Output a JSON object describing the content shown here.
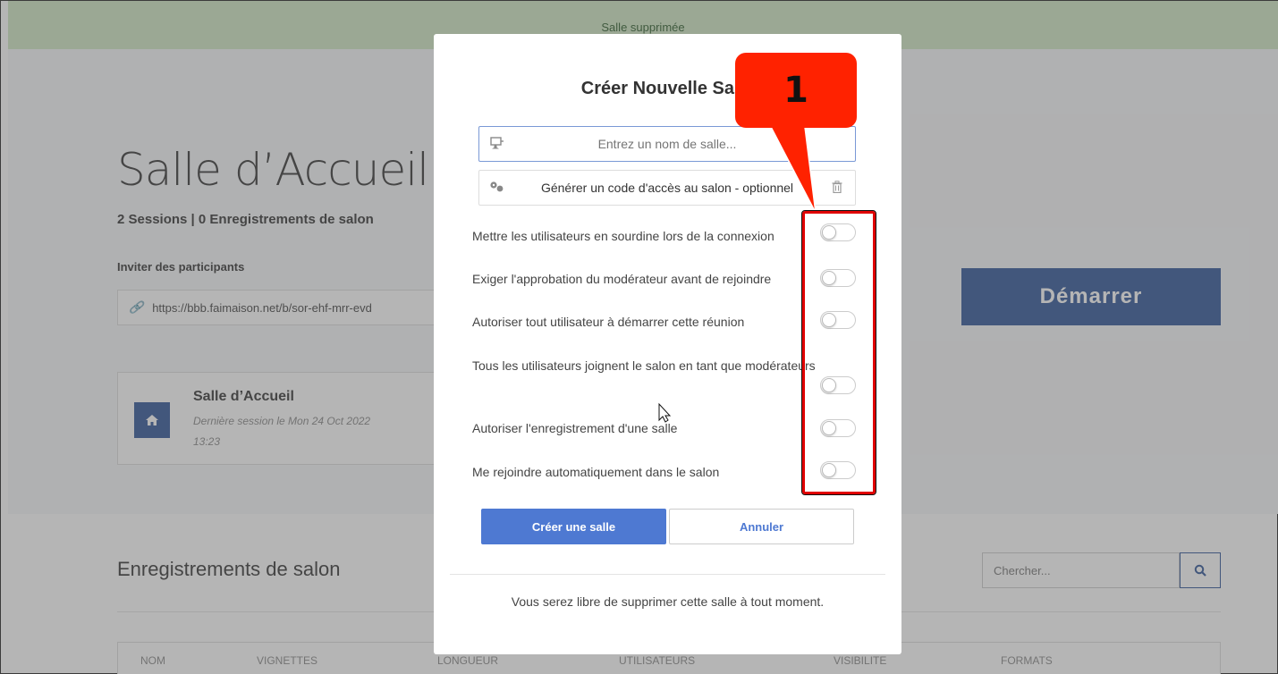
{
  "notice": {
    "text": "Salle supprimée"
  },
  "room": {
    "title": "Salle d’Accueil",
    "stats": "2 Sessions | 0 Enregistrements de salon",
    "invite_label": "Inviter des participants",
    "invite_url": "https://bbb.faimaison.net/b/sor-ehf-mrr-evd",
    "start_label": "Démarrer"
  },
  "room_card": {
    "name": "Salle d’Accueil",
    "last_session": "Dernière session le Mon 24 Oct 2022 13:23"
  },
  "recordings": {
    "title": "Enregistrements de salon",
    "search_placeholder": "Chercher...",
    "columns": [
      "NOM",
      "VIGNETTES",
      "LONGUEUR",
      "UTILISATEURS",
      "VISIBILITE",
      "FORMATS"
    ]
  },
  "modal": {
    "title": "Créer Nouvelle Salle",
    "name_placeholder": "Entrez un nom de salle...",
    "access_code_label": "Générer un code d'accès au salon - optionnel",
    "options": [
      {
        "label": "Mettre les utilisateurs en sourdine lors de la connexion",
        "enabled": false
      },
      {
        "label": "Exiger l'approbation du modérateur avant de rejoindre",
        "enabled": false
      },
      {
        "label": "Autoriser tout utilisateur à démarrer cette réunion",
        "enabled": false
      },
      {
        "label": "Tous les utilisateurs joignent le salon en tant que modérateurs",
        "enabled": false
      },
      {
        "label": "Autoriser l'enregistrement d'une salle",
        "enabled": false
      },
      {
        "label": "Me rejoindre automatiquement dans le salon",
        "enabled": false
      }
    ],
    "create_label": "Créer une salle",
    "cancel_label": "Annuler",
    "footer": "Vous serez libre de supprimer cette salle à tout moment."
  },
  "annotation": {
    "number": "1",
    "color": "#ff2200"
  },
  "icons": {
    "link": "link-icon",
    "home": "home-icon",
    "search": "search-icon",
    "room": "room-icon",
    "key": "key-icon",
    "trash": "trash-icon"
  }
}
